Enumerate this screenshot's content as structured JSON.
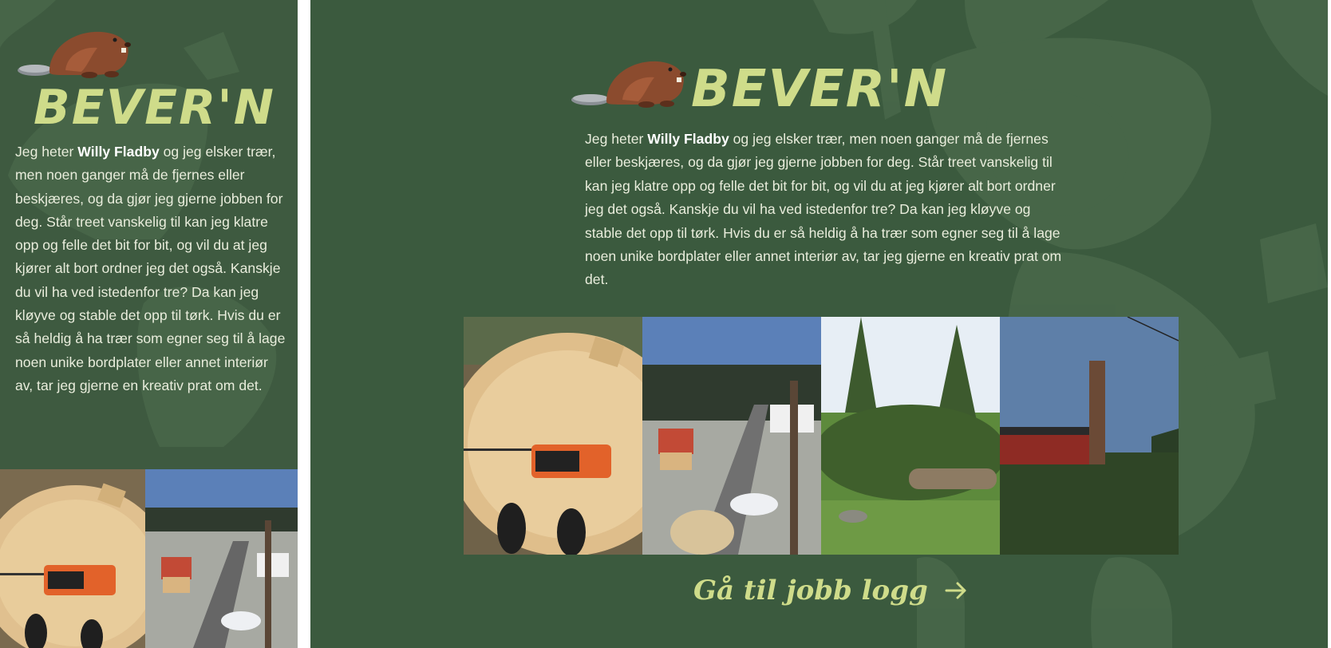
{
  "site": {
    "brand": "BEVER'N",
    "bio": {
      "intro": "Jeg heter ",
      "name": "Willy Fladby",
      "body": " og jeg elsker trær, men noen ganger må de fjernes eller beskjæres, og da gjør jeg gjerne jobben for deg. Står treet vanskelig til kan jeg klatre opp og felle det bit for bit, og vil du at jeg kjører alt bort ordner jeg det også. Kanskje du vil ha ved istedenfor tre? Da kan jeg kløyve og stable det opp til tørk. Hvis du er så heldig å ha trær som egner seg til å lage noen unike bordplater eller annet interiør av, tar jeg gjerne en kreativ prat om det."
    },
    "cta": {
      "label": "Gå til jobb logg",
      "icon": "arrow-right-icon"
    },
    "gallery": [
      {
        "name": "photo-stump-chainsaw"
      },
      {
        "name": "photo-aerial-village"
      },
      {
        "name": "photo-fallen-trees"
      },
      {
        "name": "photo-trunk-red-house"
      }
    ],
    "colors": {
      "background": "#3b5a3e",
      "accent": "#cfdc8a",
      "text": "#e9eddc"
    },
    "logo_icon": "beaver-icon"
  }
}
